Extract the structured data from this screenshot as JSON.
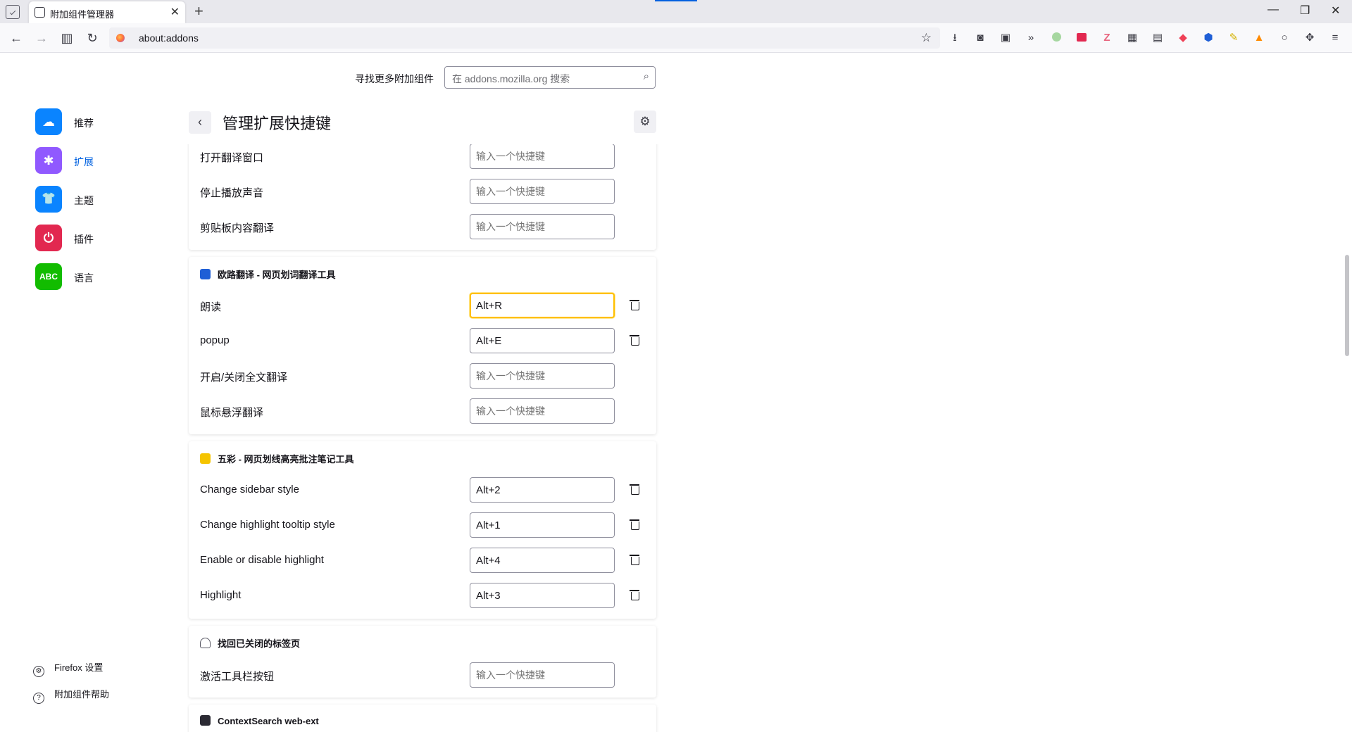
{
  "browser": {
    "tab_title": "附加组件管理器",
    "tab_close": "✕",
    "new_tab": "+",
    "url": "about:addons",
    "window_controls": [
      "—",
      "❐",
      "✕"
    ],
    "nav": {
      "back": "←",
      "forward": "→",
      "sidebar": "▥",
      "reload": "↻"
    },
    "star_icon": "☆"
  },
  "sidebar": {
    "categories": [
      {
        "label": "推荐",
        "icon": "discover-icon",
        "glyph": "☁",
        "color": "#0a84ff"
      },
      {
        "label": "扩展",
        "icon": "extensions-icon",
        "glyph": "✱",
        "color": "#9059ff",
        "active": true
      },
      {
        "label": "主题",
        "icon": "themes-icon",
        "glyph": "👕",
        "color": "#0a84ff"
      },
      {
        "label": "插件",
        "icon": "plugins-icon",
        "glyph": "⏻",
        "color": "#e22850"
      },
      {
        "label": "语言",
        "icon": "languages-icon",
        "glyph": "ABC",
        "color": "#2ac3a2"
      }
    ],
    "footer": {
      "settings": "Firefox 设置",
      "help": "附加组件帮助"
    }
  },
  "header": {
    "find_more": "寻找更多附加组件",
    "search_placeholder": "在 addons.mozilla.org 搜索",
    "page_title": "管理扩展快捷键"
  },
  "placeholder": "输入一个快捷键",
  "cards": [
    {
      "name": "",
      "rows": [
        {
          "label": "打开翻译窗口",
          "value": ""
        },
        {
          "label": "停止播放声音",
          "value": ""
        },
        {
          "label": "剪贴板内容翻译",
          "value": ""
        }
      ]
    },
    {
      "name": "欧路翻译 - 网页划词翻译工具",
      "icon_color": "#1f5fd6",
      "rows": [
        {
          "label": "朗读",
          "value": "Alt+R",
          "focused": true
        },
        {
          "label": "popup",
          "value": "Alt+E"
        },
        {
          "label": "开启/关闭全文翻译",
          "value": ""
        },
        {
          "label": "鼠标悬浮翻译",
          "value": ""
        }
      ]
    },
    {
      "name": "五彩 - 网页划线高亮批注笔记工具",
      "icon_color": "#f5c400",
      "rows": [
        {
          "label": "Change sidebar style",
          "value": "Alt+2"
        },
        {
          "label": "Change highlight tooltip style",
          "value": "Alt+1"
        },
        {
          "label": "Enable or disable highlight",
          "value": "Alt+4"
        },
        {
          "label": "Highlight",
          "value": "Alt+3"
        }
      ]
    },
    {
      "name": "找回已关闭的标签页",
      "icon_color": "#5b5b66",
      "rows": [
        {
          "label": "激活工具栏按钮",
          "value": ""
        }
      ]
    },
    {
      "name": "ContextSearch web-ext",
      "icon_color": "#2b2a33",
      "rows": []
    }
  ]
}
